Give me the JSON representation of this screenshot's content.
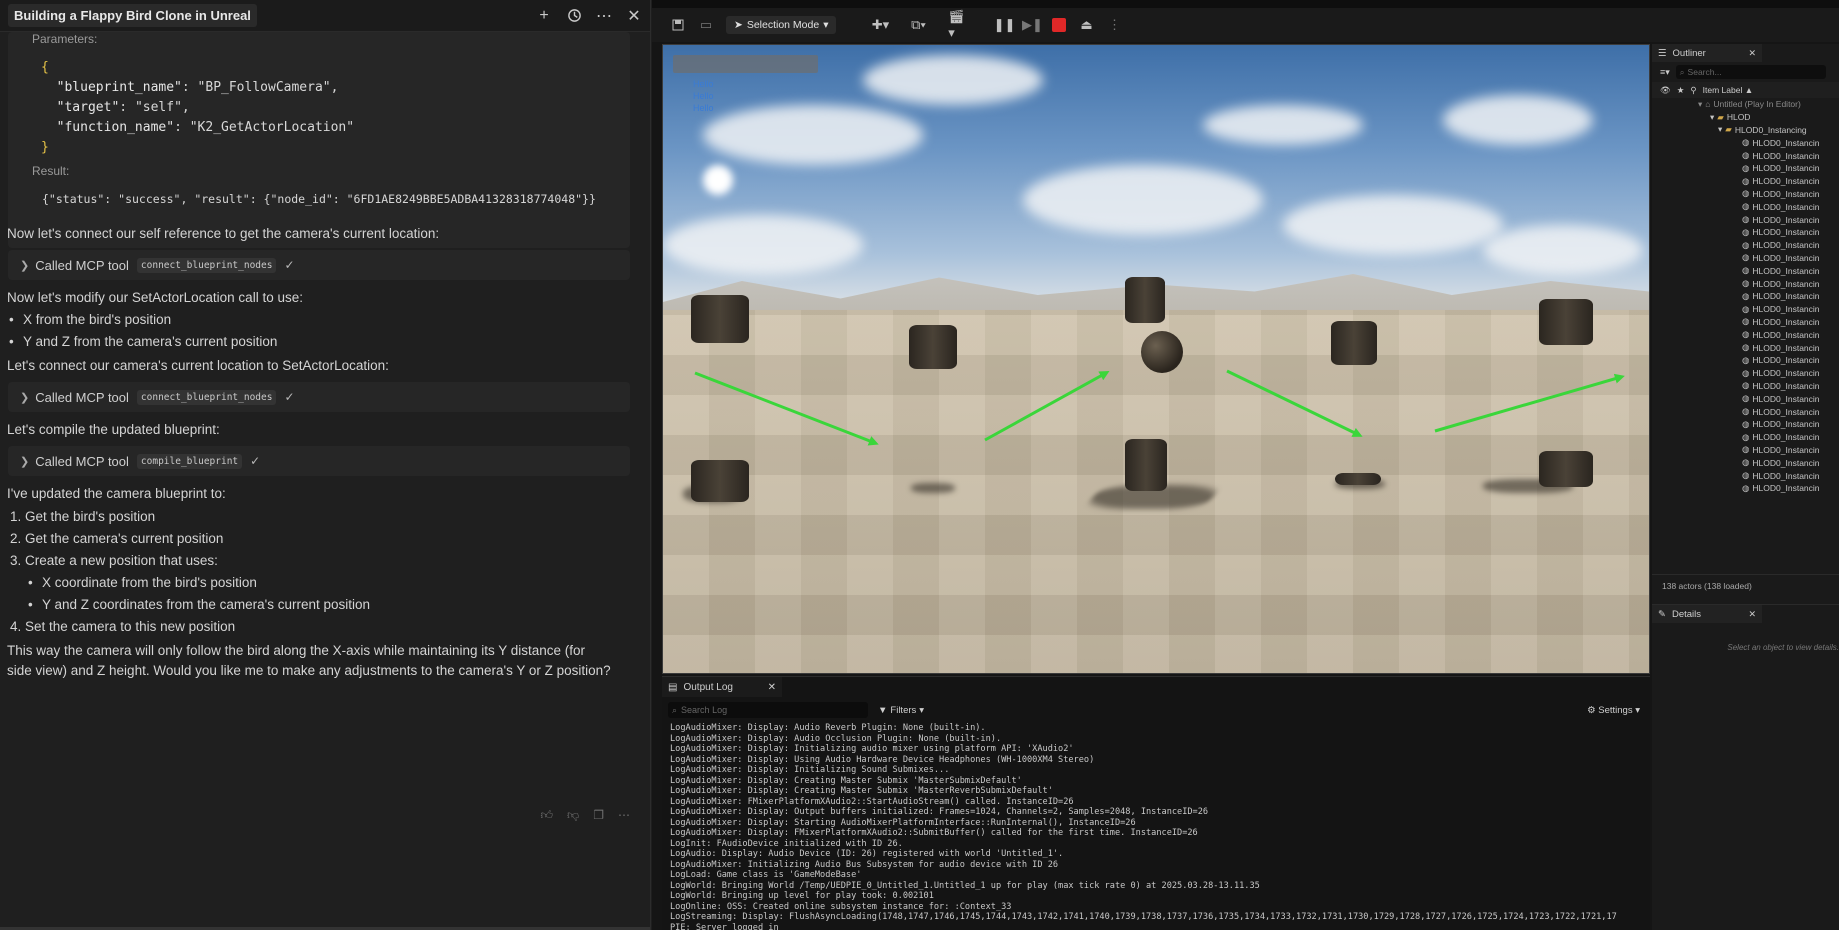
{
  "chat": {
    "title": "Building a Flappy Bird Clone in Unreal",
    "params_label": "Parameters:",
    "code_open": "{",
    "code_lines": [
      {
        "key": "\"blueprint_name\"",
        "val": "\"BP_FollowCamera\","
      },
      {
        "key": "\"target\"",
        "val": "\"self\","
      },
      {
        "key": "\"function_name\"",
        "val": "\"K2_GetActorLocation\""
      }
    ],
    "code_close": "}",
    "result_label": "Result:",
    "result_text": "{\"status\": \"success\", \"result\": {\"node_id\": \"6FD1AE8249BBE5ADBA41328318774048\"}}",
    "msg1": "Now let's connect our self reference to get the camera's current location:",
    "called_label": "Called MCP tool",
    "tool1": "connect_blueprint_nodes",
    "msg2": "Now let's modify our SetActorLocation call to use:",
    "bullets1": [
      "X from the bird's position",
      "Y and Z from the camera's current position"
    ],
    "msg3": "Let's connect our camera's current location to SetActorLocation:",
    "tool2": "connect_blueprint_nodes",
    "msg4": "Let's compile the updated blueprint:",
    "tool3": "compile_blueprint",
    "msg5": "I've updated the camera blueprint to:",
    "steps": [
      "1. Get the bird's position",
      "2. Get the camera's current position",
      "3. Create a new position that uses:"
    ],
    "sub_bullets": [
      "X coordinate from the bird's position",
      "Y and Z coordinates from the camera's current position"
    ],
    "step4": "4. Set the camera to this new position",
    "final_line1": "This way the camera will only follow the bird along the X-axis while maintaining its Y distance (for",
    "final_line2": "side view) and Z height. Would you like me to make any adjustments to the camera's Y or Z position?",
    "check": "✓"
  },
  "editor": {
    "selection_mode": "Selection Mode",
    "hello": [
      "Hello",
      "Hello",
      "Hello"
    ],
    "output_log_tab": "Output Log",
    "log_search_placeholder": "Search Log",
    "filters": "Filters",
    "settings": "Settings",
    "log_lines": [
      "LogAudioMixer: Display: Audio Reverb Plugin: None (built-in).",
      "LogAudioMixer: Display: Audio Occlusion Plugin: None (built-in).",
      "LogAudioMixer: Display: Initializing audio mixer using platform API: 'XAudio2'",
      "LogAudioMixer: Display: Using Audio Hardware Device Headphones (WH-1000XM4 Stereo)",
      "LogAudioMixer: Display: Initializing Sound Submixes...",
      "LogAudioMixer: Display: Creating Master Submix 'MasterSubmixDefault'",
      "LogAudioMixer: Display: Creating Master Submix 'MasterReverbSubmixDefault'",
      "LogAudioMixer: FMixerPlatformXAudio2::StartAudioStream() called. InstanceID=26",
      "LogAudioMixer: Display: Output buffers initialized: Frames=1024, Channels=2, Samples=2048, InstanceID=26",
      "LogAudioMixer: Display: Starting AudioMixerPlatformInterface::RunInternal(), InstanceID=26",
      "LogAudioMixer: Display: FMixerPlatformXAudio2::SubmitBuffer() called for the first time. InstanceID=26",
      "LogInit: FAudioDevice initialized with ID 26.",
      "LogAudio: Display: Audio Device (ID: 26) registered with world 'Untitled_1'.",
      "LogAudioMixer: Initializing Audio Bus Subsystem for audio device with ID 26",
      "LogLoad: Game class is 'GameModeBase'",
      "LogWorld: Bringing World /Temp/UEDPIE_0_Untitled_1.Untitled_1 up for play (max tick rate 0) at 2025.03.28-13.11.35",
      "LogWorld: Bringing up level for play took: 0.002101",
      "LogOnline: OSS: Created online subsystem instance for: :Context_33",
      "LogStreaming: Display: FlushAsyncLoading(1748,1747,1746,1745,1744,1743,1742,1741,1740,1739,1738,1737,1736,1735,1734,1733,1732,1731,1730,1729,1728,1727,1726,1725,1724,1723,1722,1721,17",
      "PIE: Server logged in"
    ],
    "outliner_tab": "Outliner",
    "outliner_search": "Search...",
    "item_label": "Item Label ▲",
    "tree_root": "Untitled (Play In Editor)",
    "tree_hlod": "HLOD",
    "tree_hlod_inst": "HLOD0_Instancing",
    "hlod_rows": 28,
    "hlod_row_label": "HLOD0_Instancin",
    "actors_count": "138 actors (138 loaded)",
    "details_tab": "Details",
    "details_empty": "Select an object to view details."
  }
}
